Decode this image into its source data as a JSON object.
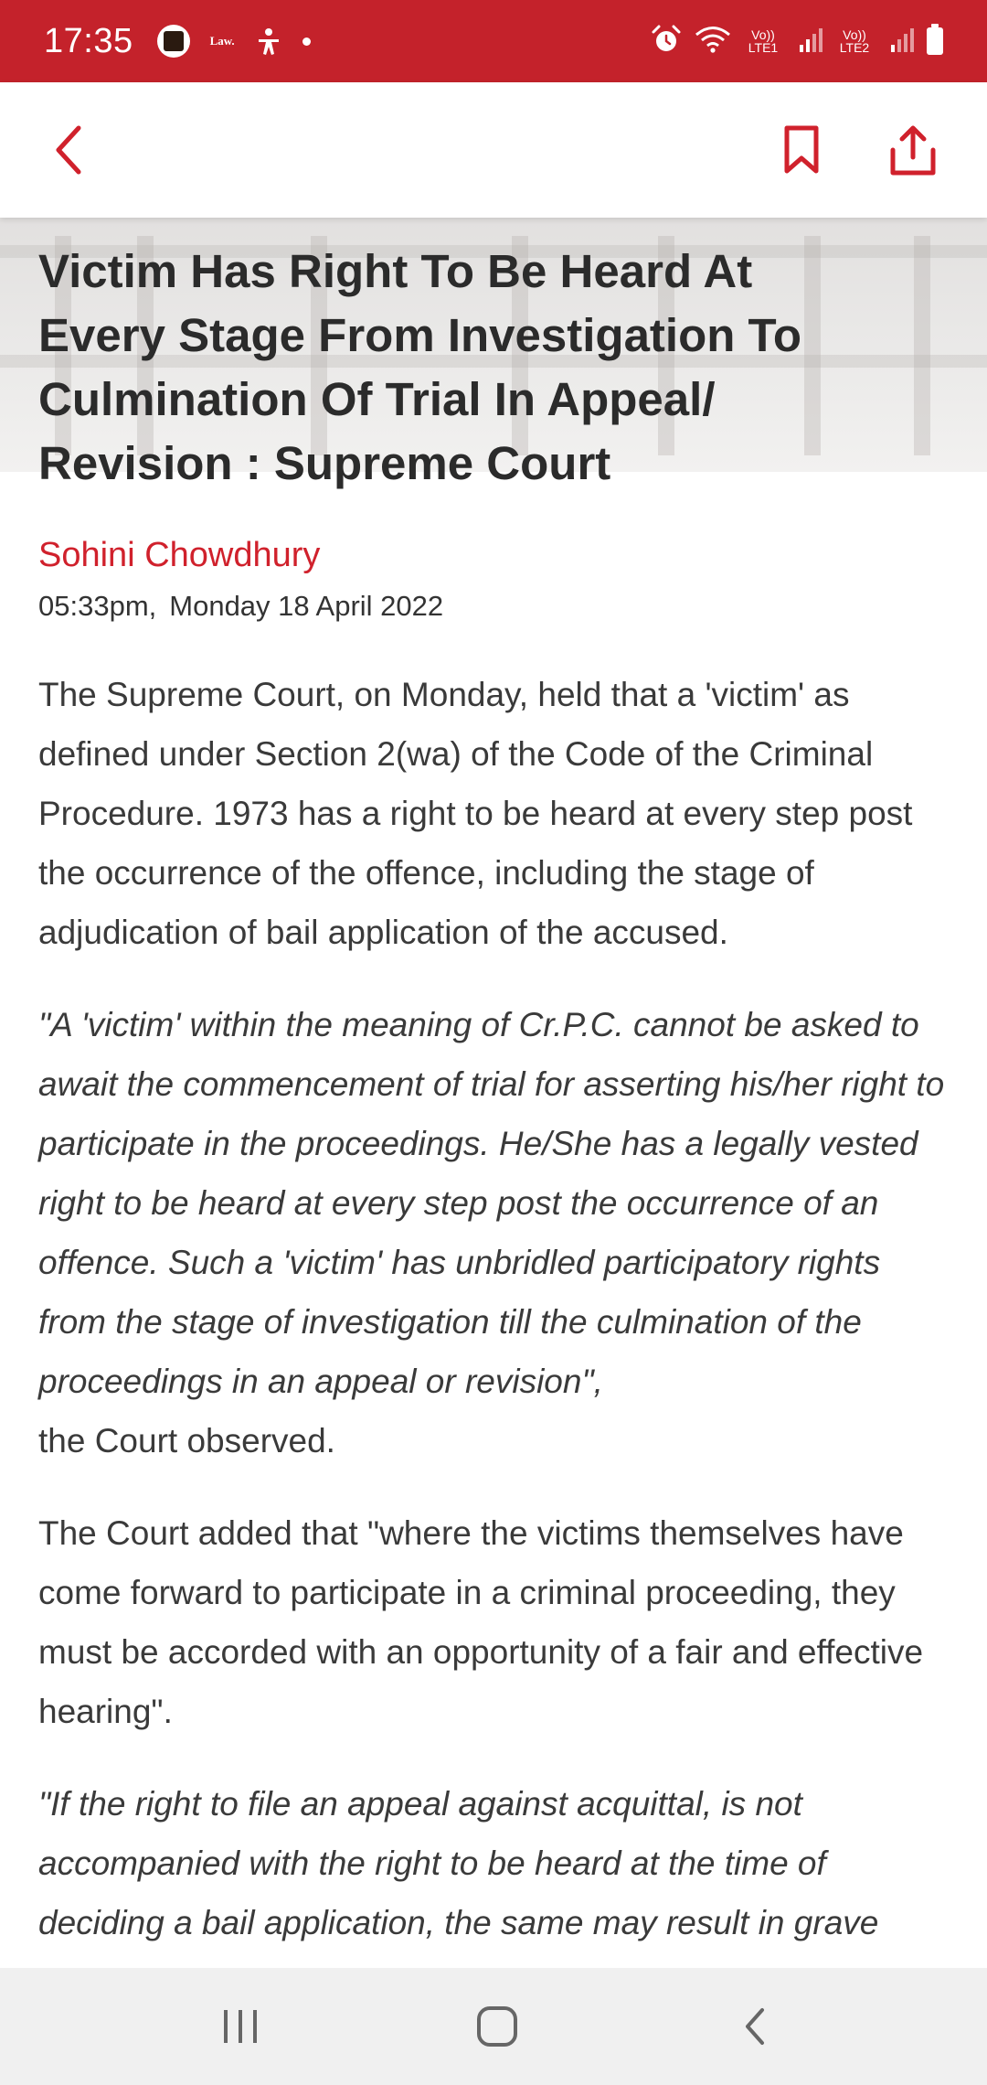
{
  "status_bar": {
    "time": "17:35",
    "notif_law_label": "Law.",
    "sim1_label": "Vo)) LTE1",
    "sim2_label": "Vo)) LTE2"
  },
  "icons": {
    "back": "back-chevron-icon",
    "bookmark": "bookmark-icon",
    "share": "share-icon",
    "nav_recents": "recents-icon",
    "nav_home": "home-icon",
    "nav_back": "nav-back-icon"
  },
  "colors": {
    "brand_red": "#c4222b",
    "author_red": "#d0212c",
    "text": "#3a3a3a"
  },
  "article": {
    "headline": "Victim Has Right To Be Heard At Every Stage From Investigation To Culmination Of Trial In Appeal/ Revision : Supreme Court",
    "author": "Sohini Chowdhury",
    "time": "05:33pm,",
    "date": "Monday 18 April 2022",
    "paragraphs": [
      "The Supreme Court, on Monday, held that a 'victim' as defined under Section 2(wa) of the Code of the Criminal Procedure. 1973 has a right to be heard at every step post the occurrence of the offence, including the stage of adjudication of bail application of the accused.",
      "\"A 'victim' within the meaning of Cr.P.C. cannot be asked to await the commencement of trial for asserting his/her right to participate in the proceedings. He/She has a legally vested right to be heard at every step post the occurrence of an offence. Such a 'victim' has unbridled participatory rights from the stage of investigation till the culmination of the proceedings in an appeal or revision\",",
      "the Court observed.",
      "The Court added that \"where the victims themselves have come forward to participate in a criminal proceeding, they must be accorded with an opportunity of a fair and effective hearing\".",
      "\"If the right to file an appeal against acquittal, is not accompanied with the right to be heard at the time of deciding a bail application, the same may result in grave"
    ]
  }
}
